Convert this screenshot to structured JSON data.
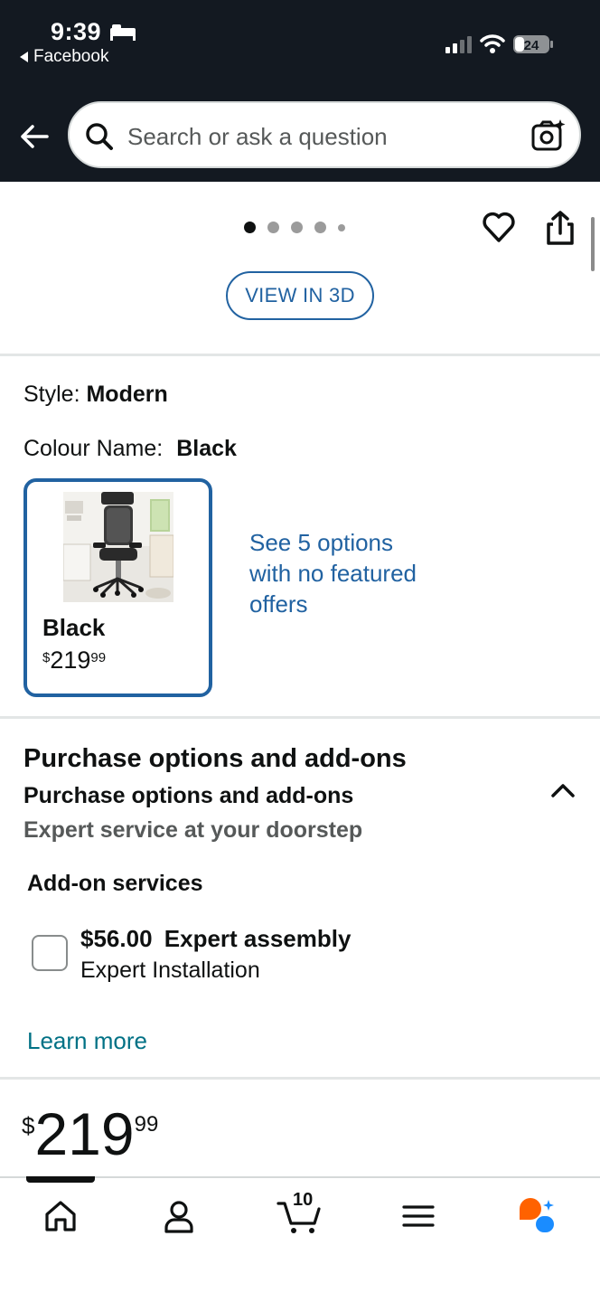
{
  "status_bar": {
    "time": "9:39",
    "back_app_label": "Facebook",
    "battery_level": "24"
  },
  "header": {
    "search_placeholder": "Search or ask a question"
  },
  "gallery": {
    "view_3d_label": "VIEW IN 3D",
    "image_count": 5,
    "active_index": 0
  },
  "variation": {
    "style_label": "Style:",
    "style_value": "Modern",
    "colour_label": "Colour Name:",
    "colour_value": "Black",
    "selected_swatch": {
      "name": "Black",
      "currency": "$",
      "price_whole": "219",
      "price_cents": "99"
    },
    "options_link": "See 5 options with no featured offers"
  },
  "purchase_options": {
    "title": "Purchase options and add-ons",
    "subtitle": "Purchase options and add-ons",
    "tagline": "Expert service at your doorstep",
    "addons_heading": "Add-on services",
    "addon": {
      "price": "$56.00",
      "name": "Expert assembly",
      "description": "Expert Installation",
      "checked": false
    },
    "learn_more": "Learn more"
  },
  "price": {
    "currency": "$",
    "whole": "219",
    "cents": "99"
  },
  "bottom_nav": {
    "cart_count": "10",
    "items": [
      "home-icon",
      "account-icon",
      "cart-icon",
      "menu-icon",
      "rufus-icon"
    ]
  },
  "colors": {
    "header_bg": "#131921",
    "link": "#2162a1",
    "teal_link": "#007185",
    "rufus_orange": "#ff6200",
    "rufus_blue": "#1a8cff"
  }
}
